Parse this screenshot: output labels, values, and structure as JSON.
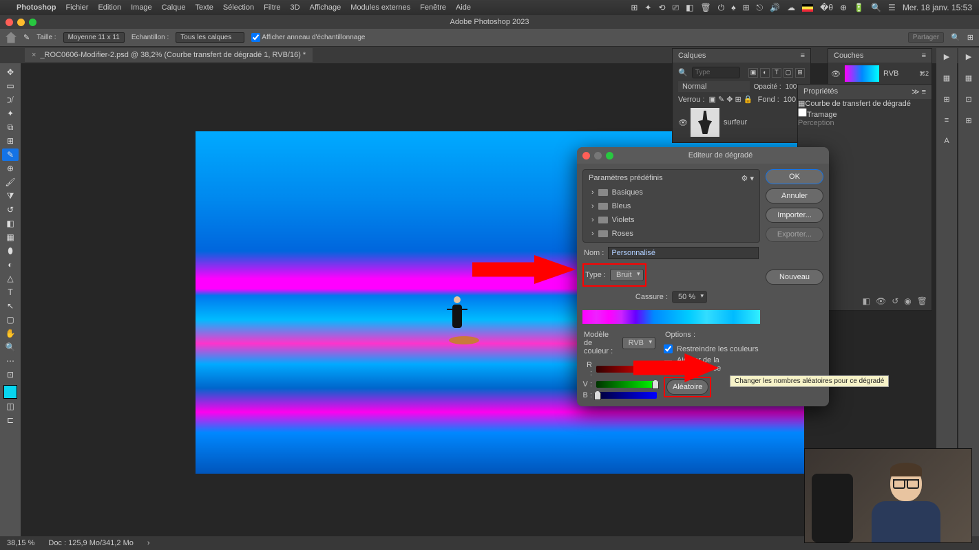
{
  "menubar": {
    "app": "Photoshop",
    "items": [
      "Fichier",
      "Edition",
      "Image",
      "Calque",
      "Texte",
      "Sélection",
      "Filtre",
      "3D",
      "Affichage",
      "Modules externes",
      "Fenêtre",
      "Aide"
    ],
    "datetime": "Mer. 18 janv. 15:53"
  },
  "window": {
    "title": "Adobe Photoshop 2023"
  },
  "optbar": {
    "taille_label": "Taille :",
    "taille_val": "Moyenne 11 x 11",
    "echant_label": "Echantillon :",
    "echant_val": "Tous les calques",
    "ring_label": "Afficher anneau d'échantillonnage",
    "share": "Partager"
  },
  "tab": {
    "name": "_ROC0606-Modifier-2.psd @ 38,2% (Courbe transfert de dégradé 1, RVB/16) *"
  },
  "layers": {
    "title": "Calques",
    "filter_placeholder": "Type",
    "blend": "Normal",
    "opacity_label": "Opacité :",
    "opacity_val": "100 %",
    "verrou": "Verrou :",
    "fond_label": "Fond :",
    "fond_val": "100 %",
    "layer1": "surfeur"
  },
  "couches": {
    "title": "Couches",
    "name": "RVB",
    "shortcut": "⌘2"
  },
  "props": {
    "title": "Propriétés",
    "type": "Courbe de transfert de dégradé",
    "tramage": "Tramage",
    "method": "Perception"
  },
  "dialog": {
    "title": "Editeur de dégradé",
    "presets_label": "Paramètres prédéfinis",
    "presets": [
      "Basiques",
      "Bleus",
      "Violets",
      "Roses"
    ],
    "ok": "OK",
    "cancel": "Annuler",
    "import": "Importer...",
    "export": "Exporter...",
    "new": "Nouveau",
    "nom_label": "Nom :",
    "nom_val": "Personnalisé",
    "type_label": "Type :",
    "type_val": "Bruit",
    "cassure_label": "Cassure :",
    "cassure_val": "50 %",
    "model_label": "Modèle de couleur :",
    "model_val": "RVB",
    "options_label": "Options :",
    "r": "R :",
    "v": "V :",
    "b": "B :",
    "restrict": "Restreindre les couleurs",
    "transp": "Ajouter de la transparence",
    "random": "Aléatoire",
    "tooltip": "Changer les nombres aléatoires pour ce dégradé"
  },
  "status": {
    "zoom": "38,15 %",
    "doc": "Doc : 125,9 Mo/341,2 Mo"
  }
}
